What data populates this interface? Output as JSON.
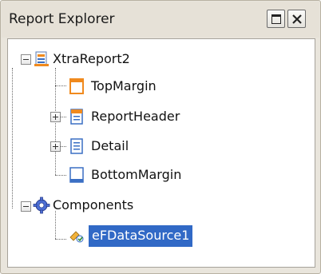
{
  "window": {
    "title": "Report Explorer",
    "maximize_icon": "maximize-icon",
    "close_icon": "close-icon"
  },
  "tree": {
    "root": {
      "label": "XtraReport2",
      "icon": "report-icon",
      "expanded": true,
      "children": [
        {
          "label": "TopMargin",
          "icon": "top-margin-band-icon"
        },
        {
          "label": "ReportHeader",
          "icon": "report-header-band-icon",
          "expandable": true
        },
        {
          "label": "Detail",
          "icon": "detail-band-icon",
          "expandable": true
        },
        {
          "label": "BottomMargin",
          "icon": "bottom-margin-band-icon"
        }
      ]
    },
    "components": {
      "label": "Components",
      "icon": "components-gear-icon",
      "expanded": true,
      "children": [
        {
          "label": "eFDataSource1",
          "icon": "data-source-icon",
          "selected": true
        }
      ]
    }
  },
  "colors": {
    "selection": "#3169c6",
    "panel_bg": "#e9e5dc",
    "band_orange": "#f08a1e",
    "band_blue": "#3a6fc4"
  }
}
